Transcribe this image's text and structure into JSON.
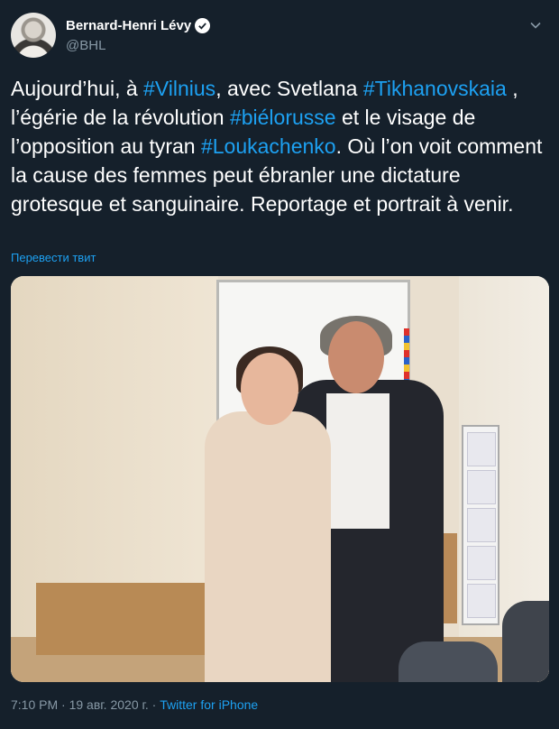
{
  "header": {
    "name": "Bernard-Henri Lévy",
    "handle": "@BHL",
    "verified_icon": "verified-badge-icon",
    "menu_icon": "chevron-down-icon"
  },
  "tweet": {
    "segments": [
      {
        "text": "Aujourd’hui, à ",
        "tag": false
      },
      {
        "text": "#Vilnius",
        "tag": true
      },
      {
        "text": ", avec Svetlana ",
        "tag": false
      },
      {
        "text": "#Tikhanovskaia",
        "tag": true
      },
      {
        "text": " , l’égérie de la révolution ",
        "tag": false
      },
      {
        "text": "#biélorusse",
        "tag": true
      },
      {
        "text": " et le visage de l’opposition au tyran ",
        "tag": false
      },
      {
        "text": "#Loukachenko",
        "tag": true
      },
      {
        "text": ". Où l’on voit comment la cause des femmes peut ébranler une dictature grotesque et sanguinaire. Reportage et portrait à venir.",
        "tag": false
      }
    ],
    "translate_label": "Перевести твит"
  },
  "photo": {
    "alt": "photo"
  },
  "footer": {
    "time": "7:10 PM",
    "separator1": " · ",
    "date": "19 авг. 2020 г.",
    "separator2": " · ",
    "source": "Twitter for iPhone"
  },
  "colors": {
    "background": "#15202b",
    "link": "#1da1f2",
    "secondary": "#8899a6"
  }
}
